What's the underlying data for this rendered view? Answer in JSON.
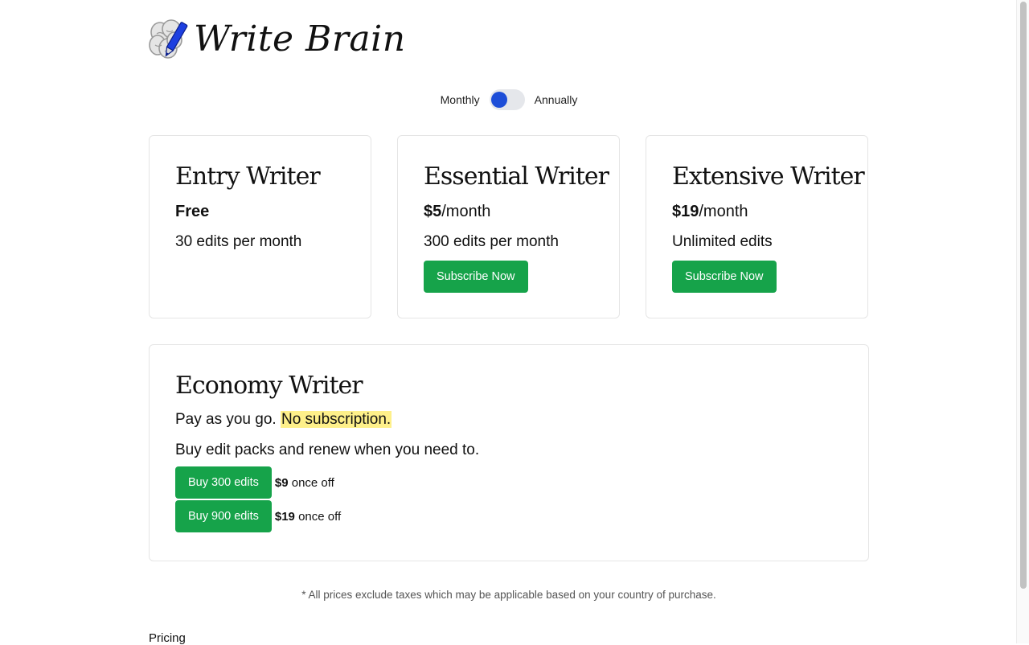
{
  "brand": {
    "name": "Write Brain"
  },
  "billing": {
    "monthly_label": "Monthly",
    "annually_label": "Annually",
    "selected": "Monthly"
  },
  "plans": [
    {
      "title": "Entry Writer",
      "price_bold": "Free",
      "price_suffix": "",
      "edits": "30 edits per month",
      "cta": ""
    },
    {
      "title": "Essential Writer",
      "price_bold": "$5",
      "price_suffix": "/month",
      "edits": "300 edits per month",
      "cta": "Subscribe Now"
    },
    {
      "title": "Extensive Writer",
      "price_bold": "$19",
      "price_suffix": "/month",
      "edits": "Unlimited edits",
      "cta": "Subscribe Now"
    }
  ],
  "economy": {
    "title": "Economy Writer",
    "line1_plain": "Pay as you go.",
    "line1_highlight": "No subscription.",
    "line2": "Buy edit packs and renew when you need to.",
    "packs": [
      {
        "button": "Buy 300 edits",
        "price": "$9",
        "note": "once off"
      },
      {
        "button": "Buy 900 edits",
        "price": "$19",
        "note": "once off"
      }
    ]
  },
  "footnote": "* All prices exclude taxes which may be applicable based on your country of purchase.",
  "bottom_link": "Pricing",
  "colors": {
    "button_green": "#16a34a",
    "toggle_blue": "#1d4ed8",
    "highlight_yellow": "#fef08a"
  }
}
